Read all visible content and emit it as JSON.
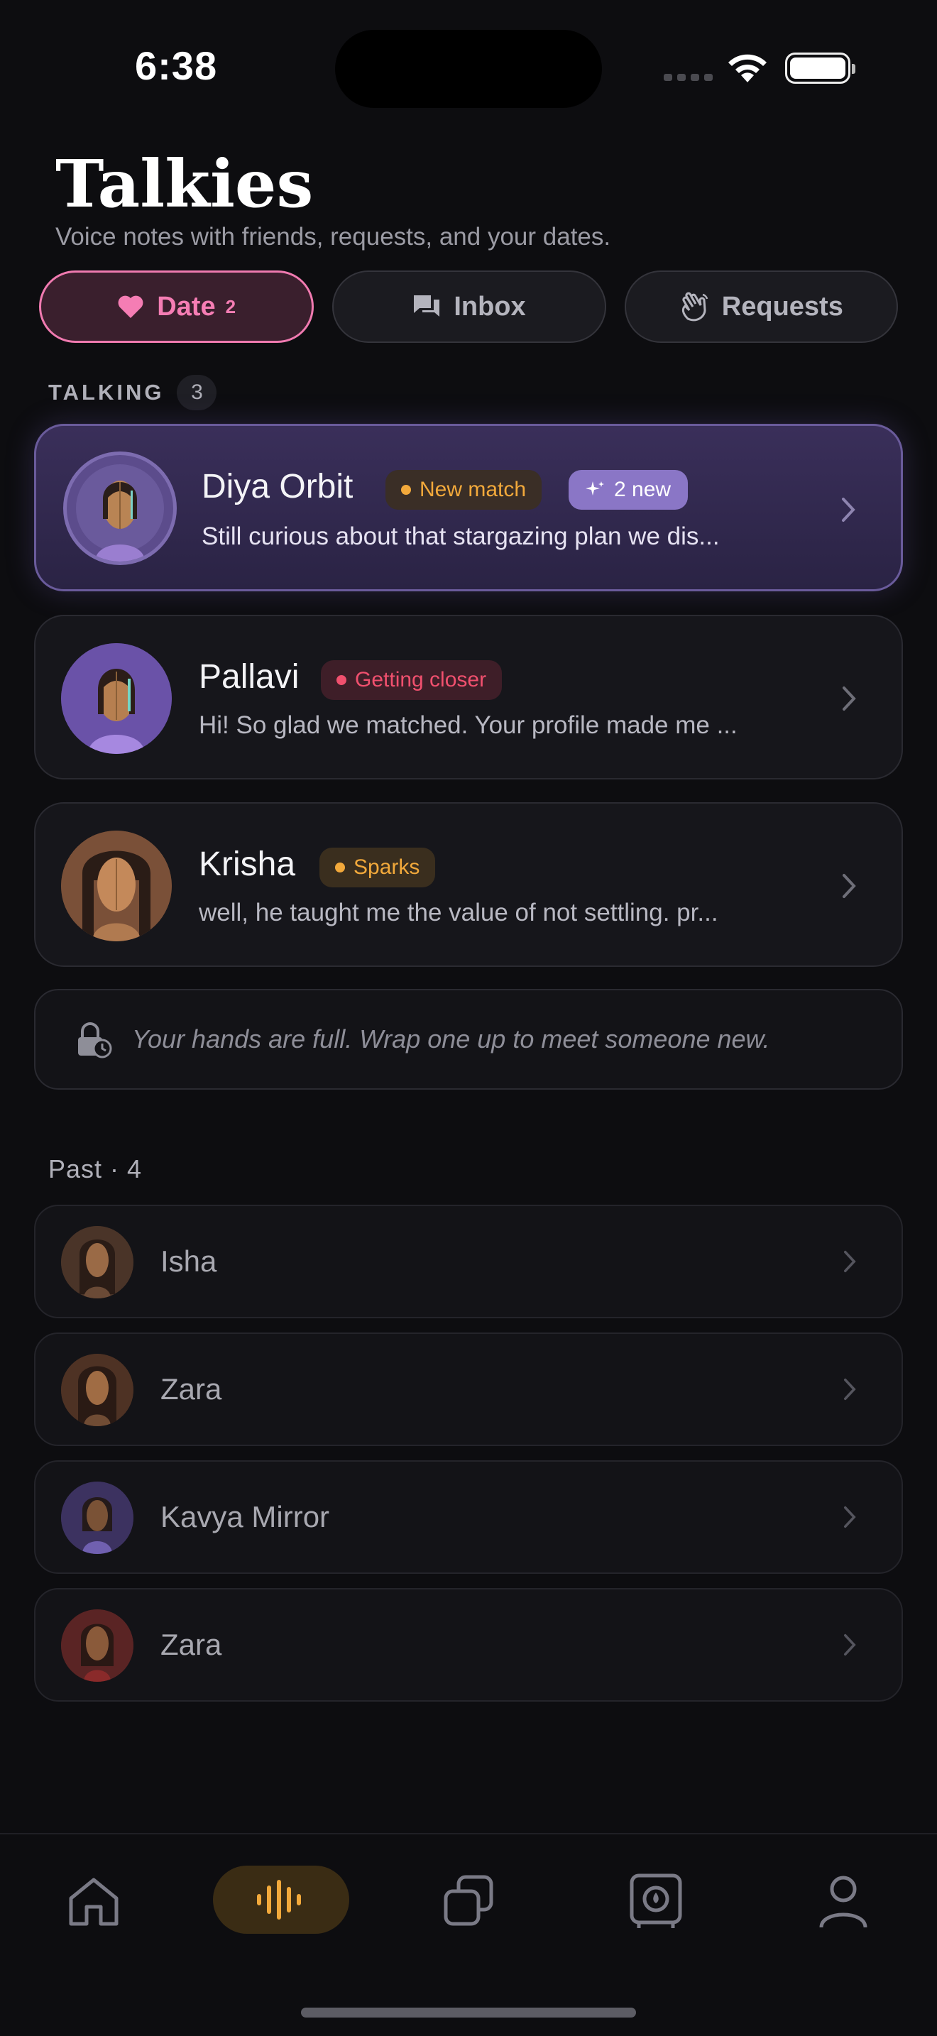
{
  "status": {
    "time": "6:38"
  },
  "header": {
    "title": "Talkies",
    "subtitle": "Voice notes with friends, requests, and your dates."
  },
  "tabs": [
    {
      "label": "Date",
      "count": "2",
      "icon": "heart-icon",
      "active": true
    },
    {
      "label": "Inbox",
      "icon": "chat-bubbles-icon",
      "active": false
    },
    {
      "label": "Requests",
      "icon": "waving-hand-icon",
      "active": false
    }
  ],
  "talking": {
    "label": "TALKING",
    "count": "3",
    "items": [
      {
        "name": "Diya Orbit",
        "badge": "New match",
        "badge_color": "#f2a93b",
        "new_badge": "2 new",
        "preview": "Still curious about that stargazing plan we dis...",
        "active": true
      },
      {
        "name": "Pallavi",
        "badge": "Getting closer",
        "badge_color": "#f0506e",
        "preview": "Hi! So glad we matched. Your profile made me ...",
        "active": false
      },
      {
        "name": "Krisha",
        "badge": "Sparks",
        "badge_color": "#f2a93b",
        "preview": "well, he taught me the value of not settling. pr...",
        "active": false
      }
    ]
  },
  "lock_notice": {
    "icon": "lock-clock-icon",
    "text": "Your hands are full. Wrap one up to meet someone new."
  },
  "past": {
    "label": "Past · 4",
    "items": [
      {
        "name": "Isha"
      },
      {
        "name": "Zara"
      },
      {
        "name": "Kavya Mirror"
      },
      {
        "name": "Zara"
      }
    ]
  },
  "bottom_nav": {
    "items": [
      "home-icon",
      "voice-wave-icon",
      "cards-stack-icon",
      "safe-icon",
      "profile-icon"
    ],
    "active": "voice-wave-icon",
    "active_color": "#f2a93b"
  }
}
